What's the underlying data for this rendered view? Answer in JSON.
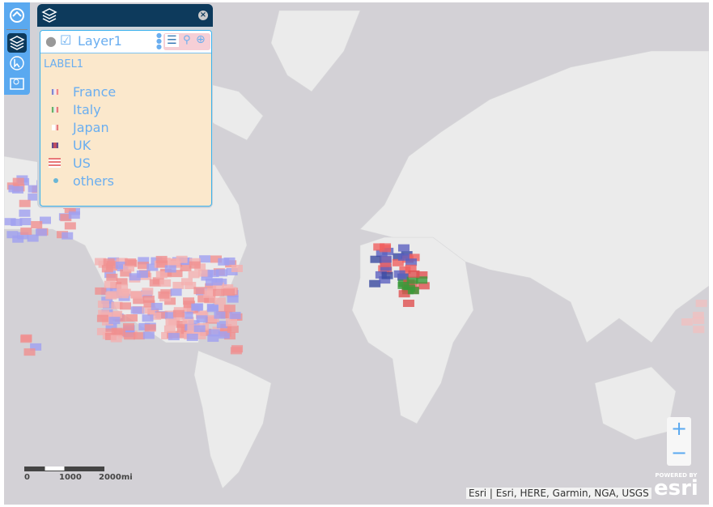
{
  "toolbar": {
    "buttons": [
      "home",
      "layers",
      "select",
      "print"
    ]
  },
  "panel": {
    "layer_name": "Layer1",
    "layer_checked": true,
    "label": "LABEL1",
    "legend": [
      {
        "label": "France"
      },
      {
        "label": "Italy"
      },
      {
        "label": "Japan"
      },
      {
        "label": "UK"
      },
      {
        "label": "US"
      },
      {
        "label": "others"
      }
    ]
  },
  "zoom": {
    "in": "+",
    "out": "−"
  },
  "scale": {
    "t0": "0",
    "t1": "1000",
    "t2": "2000mi"
  },
  "attribution": "Esri | Esri, HERE, Garmin, NGA, USGS",
  "logo": {
    "powered": "POWERED BY",
    "name": "esri"
  }
}
